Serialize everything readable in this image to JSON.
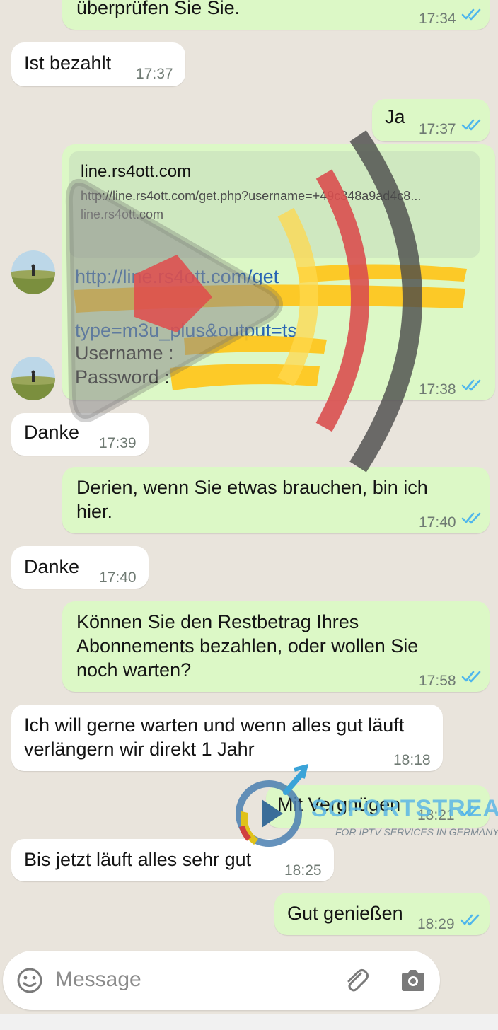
{
  "colors": {
    "chat_background": "#e9e4dc",
    "incoming_bubble": "#ffffff",
    "outgoing_bubble": "#dcf8c6",
    "read_tick": "#4fb6ec",
    "link": "#2864b4"
  },
  "messages": [
    {
      "direction": "out",
      "text": "überprüfen Sie Sie.",
      "time": "17:34",
      "read": true
    },
    {
      "direction": "in",
      "text": "Ist bezahlt",
      "time": "17:37"
    },
    {
      "direction": "out",
      "text": "Ja",
      "time": "17:37",
      "read": true
    },
    {
      "direction": "out",
      "time": "17:38",
      "read": true,
      "link_preview": {
        "title": "line.rs4ott.com",
        "url": "http://line.rs4ott.com/get.php?username=+49c348a9ad4c8...",
        "domain": "line.rs4ott.com"
      },
      "lines": [
        "http://line.rs4ott.com/get",
        "type=m3u_plus&output=ts",
        "Username :",
        "Password :"
      ]
    },
    {
      "direction": "in",
      "text": "Danke",
      "time": "17:39"
    },
    {
      "direction": "out",
      "text_lines": [
        "Derien, wenn Sie etwas brauchen, bin ich",
        "hier."
      ],
      "time": "17:40",
      "read": true
    },
    {
      "direction": "in",
      "text": "Danke",
      "time": "17:40"
    },
    {
      "direction": "out",
      "text_lines": [
        "Können Sie den Restbetrag Ihres",
        "Abonnements bezahlen, oder wollen Sie",
        "noch warten?"
      ],
      "time": "17:58",
      "read": true
    },
    {
      "direction": "in",
      "text_lines": [
        "Ich will gerne warten und wenn alles gut läuft",
        "verlängern wir direkt 1 Jahr"
      ],
      "time": "18:18"
    },
    {
      "direction": "out",
      "text": "Mit Vergnügen",
      "time": "18:21",
      "read": true
    },
    {
      "direction": "in",
      "text": "Bis jetzt läuft alles sehr gut",
      "time": "18:25"
    },
    {
      "direction": "out",
      "text": "Gut genießen",
      "time": "18:29",
      "read": true
    }
  ],
  "composer": {
    "placeholder": "Message",
    "emoji_icon": "emoji-icon",
    "attach_icon": "paperclip-icon",
    "camera_icon": "camera-icon"
  },
  "watermark": {
    "brand": "SOFORTSTREAM",
    "tagline": "FOR IPTV SERVICES IN GERMANY"
  }
}
